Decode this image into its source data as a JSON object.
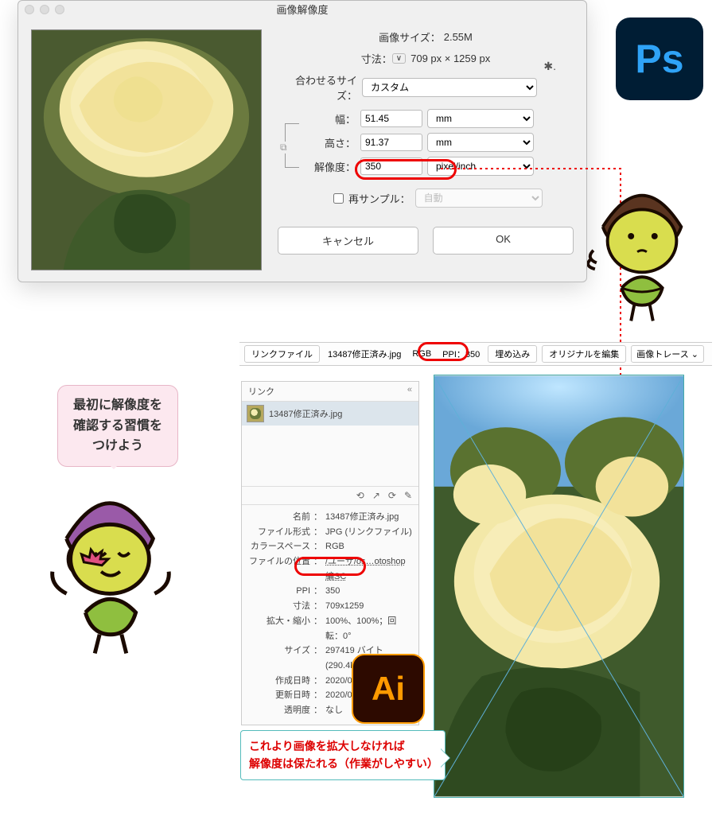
{
  "ps_dialog": {
    "title": "画像解像度",
    "image_size_label": "画像サイズ：",
    "image_size_value": "2.55M",
    "dimensions_label": "寸法：",
    "dimensions_value": "709 px × 1259 px",
    "fit_label": "合わせるサイズ：",
    "fit_value": "カスタム",
    "width_label": "幅：",
    "width_value": "51.45",
    "height_label": "高さ：",
    "height_value": "91.37",
    "unit_wh": "mm",
    "resolution_label": "解像度：",
    "resolution_value": "350",
    "resolution_unit": "pixel/inch",
    "resample_label": "再サンプル：",
    "resample_value": "自動",
    "cancel": "キャンセル",
    "ok": "OK"
  },
  "ps_badge": "Ps",
  "ai_badge": "Ai",
  "ai_toolbar": {
    "link_file": "リンクファイル",
    "filename": "13487修正済み.jpg",
    "colorspace": "RGB",
    "ppi": "PPI：350",
    "embed": "埋め込み",
    "edit_original": "オリジナルを編集",
    "image_trace": "画像トレース"
  },
  "link_panel": {
    "title": "リンク",
    "item_name": "13487修正済み.jpg",
    "rows": {
      "name_k": "名前",
      "name_v": "13487修正済み.jpg",
      "format_k": "ファイル形式",
      "format_v": "JPG (リンクファイル)",
      "space_k": "カラースペース",
      "space_v": "RGB",
      "loc_k": "ファイルの位置",
      "loc_v": "/ユーザ/os…otoshop編SC",
      "ppi_k": "PPI",
      "ppi_v": "350",
      "dim_k": "寸法",
      "dim_v": "709x1259",
      "scale_k": "拡大・縮小",
      "scale_v": "100%、100%；回転：0°",
      "size_k": "サイズ",
      "size_v": "297419 バイト (290.4k)",
      "created_k": "作成日時",
      "created_v": "2020/05/14 15:10:12",
      "updated_k": "更新日時",
      "updated_v": "2020/05/14 17:20:19",
      "trans_k": "透明度",
      "trans_v": "なし"
    }
  },
  "bubble1_l1": "最初に解像度を",
  "bubble1_l2": "確認する習慣を",
  "bubble1_l3": "つけよう",
  "bubble2_l1": "これより画像を拡大しなければ",
  "bubble2_l2": "解像度は保たれる（作業がしやすい）",
  "chart_data": null
}
